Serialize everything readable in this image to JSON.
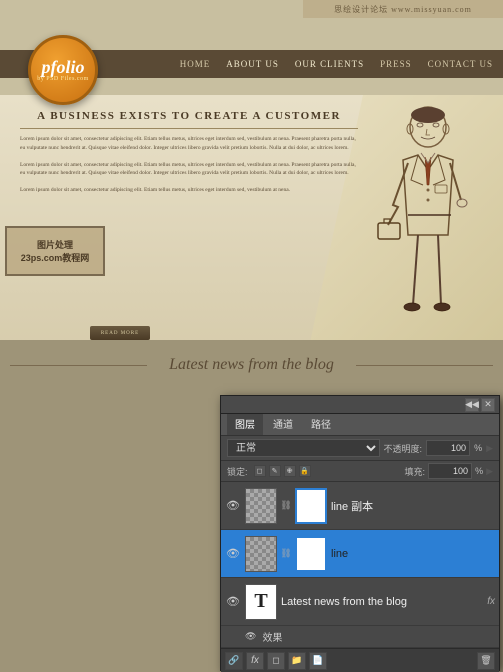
{
  "watermark": {
    "top_text": "思绘设计论坛 www.missyuan.com",
    "bottom_text1": "图片处理",
    "bottom_text2": "23ps.com教程网"
  },
  "website": {
    "logo": {
      "text": "pfolio",
      "subtext": "by PSD Files.com"
    },
    "nav": {
      "items": [
        "HOME",
        "ABOUT US",
        "OUR CLIENTS",
        "PRESS",
        "CONTACT US"
      ]
    },
    "hero": {
      "headline": "A BUSINESS EXISTS TO CREATE A CUSTOMER",
      "paragraph1": "Lorem ipsum dolor sit amet, consectetur adipiscing elit. Etiam tellus metus, ultrices eget interdum sed, vestibulum at nena. Praesent pharetra porta nulla, eu vulputate nunc hendrerit at. Quisque vitae eleifend dolor. Integer ultrices libero gravida velit pretium lobortis. Nulla at dui dolor, ac ultrices lorem.",
      "paragraph2": "Lorem ipsum dolor sit amet, consectetur adipiscing elit. Etiam tellus metus, ultrices eget interdum sed, vestibulum at nena. Praesent pharetra porta nulla, eu vulputate nunc hendrerit at. Quisque vitae eleifend dolor. Integer ultrices libero gravida velit pretium lobortis. Nulla at dui dolor, ac ultrices lorem.",
      "paragraph3": "Lorem ipsum dolor sit amet, consectetur adipiscing elit. Etiam tellus metus, ultrices eget interdum sed, vestibulum at nena.",
      "cta_button": "READ MORE"
    },
    "blog": {
      "title": "Latest news from the blog"
    }
  },
  "photoshop": {
    "titlebar_buttons": [
      "◀◀",
      "✕"
    ],
    "tabs": [
      "图层",
      "通道",
      "路径"
    ],
    "active_tab": "图层",
    "blend_mode": "正常",
    "opacity_label": "不透明度:",
    "opacity_value": "100%",
    "lock_label": "锁定:",
    "fill_label": "填充:",
    "fill_value": "100%",
    "layers": [
      {
        "name": "line 副本",
        "visible": true,
        "selected": false,
        "has_checker": true,
        "has_white": true,
        "is_text": false
      },
      {
        "name": "line",
        "visible": true,
        "selected": true,
        "has_checker": true,
        "has_white": true,
        "is_text": false
      },
      {
        "name": "Latest news from the blog",
        "visible": true,
        "selected": false,
        "is_text": true,
        "fx": "fx"
      }
    ],
    "effects_label": "效果",
    "bottom_icons": [
      "🔗",
      "fx",
      "◻",
      "🗑"
    ]
  }
}
